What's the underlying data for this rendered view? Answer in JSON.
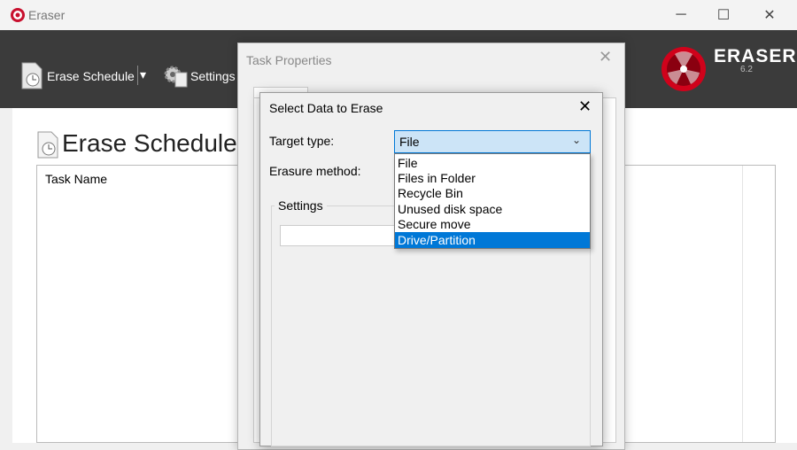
{
  "window": {
    "title": "Eraser",
    "controls": {
      "minimize": "─",
      "maximize": "☐",
      "close": "✕"
    }
  },
  "toolbar": {
    "erase_schedule_label": "Erase Schedule",
    "dropdown_arrow": "▾",
    "settings_label": "Settings"
  },
  "logo": {
    "name": "ERASER",
    "version": "6.2"
  },
  "main": {
    "page_title": "Erase Schedule",
    "columns": [
      "Task Name"
    ]
  },
  "task_properties_dialog": {
    "title": "Task Properties",
    "close_glyph": "✕"
  },
  "select_data_dialog": {
    "title": "Select Data to Erase",
    "close_glyph": "✕",
    "target_type_label": "Target type:",
    "erasure_method_label": "Erasure method:",
    "target_type_value": "File",
    "combo_arrow": "⌄",
    "settings_group_label": "Settings",
    "target_type_options": [
      "File",
      "Files in Folder",
      "Recycle Bin",
      "Unused disk space",
      "Secure move",
      "Drive/Partition"
    ],
    "highlighted_option": "Drive/Partition"
  },
  "colors": {
    "toolbar_bg": "#3b3b3b",
    "selection": "#0078d7",
    "combo_bg": "#cce4f7",
    "logo_red": "#d0021b"
  }
}
